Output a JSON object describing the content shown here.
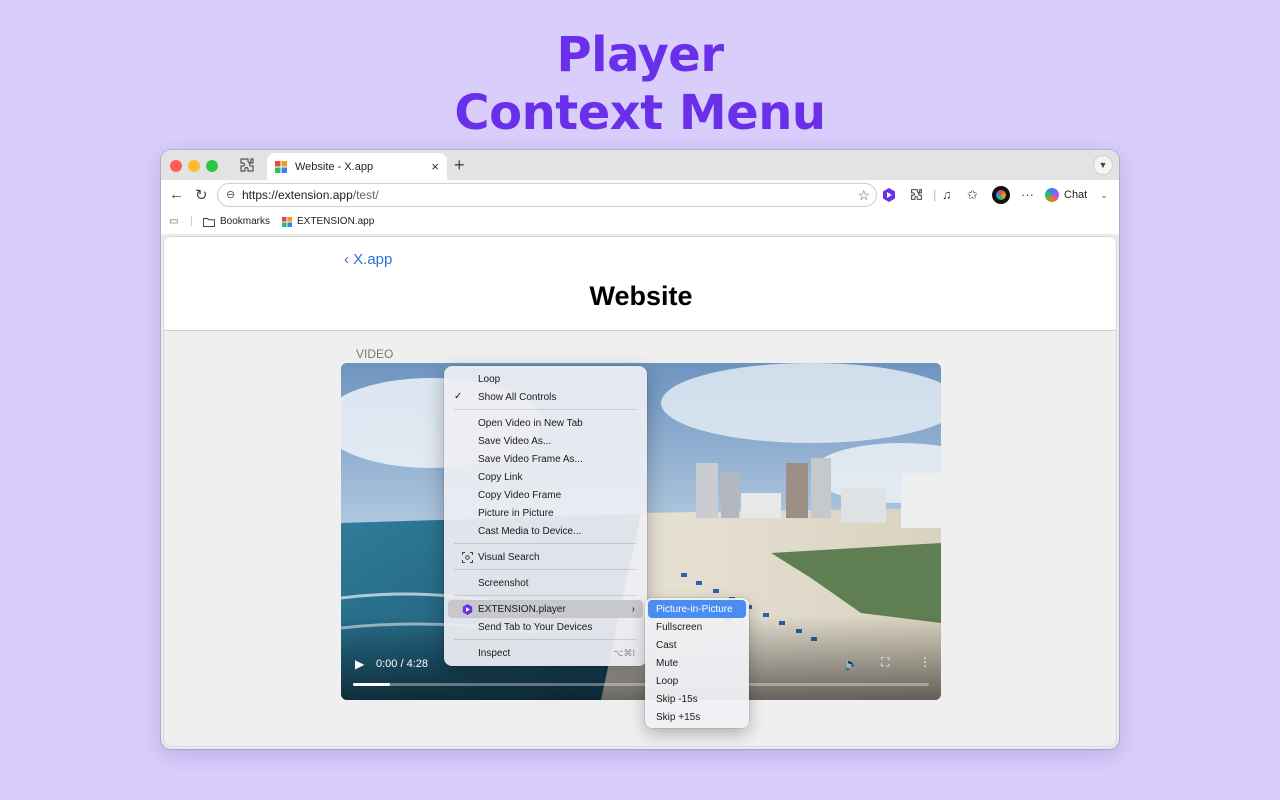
{
  "hero": {
    "line1": "Player",
    "line2": "Context Menu"
  },
  "browser": {
    "tab_title": "Website - X.app",
    "tab_close": "×",
    "new_tab": "+",
    "url_host": "https://extension.app",
    "url_path": "/test/",
    "chat_label": "Chat",
    "bookmarks": [
      {
        "label": "Bookmarks"
      },
      {
        "label": "EXTENSION.app"
      }
    ]
  },
  "page": {
    "back_label": "X.app",
    "title": "Website",
    "section_label": "VIDEO"
  },
  "video": {
    "time": "0:00 / 4:28",
    "progress_fraction": 0.065
  },
  "context_menu": {
    "items": [
      {
        "label": "Loop"
      },
      {
        "label": "Show All Controls",
        "checked": "✓"
      },
      {
        "label": "Open Video in New Tab"
      },
      {
        "label": "Save Video As..."
      },
      {
        "label": "Save Video Frame As..."
      },
      {
        "label": "Copy Link"
      },
      {
        "label": "Copy Video Frame"
      },
      {
        "label": "Picture in Picture"
      },
      {
        "label": "Cast Media to Device..."
      },
      {
        "label": "Visual Search"
      },
      {
        "label": "Screenshot"
      },
      {
        "label": "EXTENSION.player",
        "arrow": "›"
      },
      {
        "label": "Send Tab to Your Devices"
      },
      {
        "label": "Inspect",
        "shortcut": "⌥⌘I"
      }
    ]
  },
  "submenu": {
    "items": [
      {
        "label": "Picture-in-Picture"
      },
      {
        "label": "Fullscreen"
      },
      {
        "label": "Cast"
      },
      {
        "label": "Mute"
      },
      {
        "label": "Loop"
      },
      {
        "label": "Skip -15s"
      },
      {
        "label": "Skip +15s"
      }
    ]
  },
  "colors": {
    "background": "#d8cdfb",
    "hero_text": "#6a2fe8",
    "link": "#2f6fd6",
    "submenu_highlight": "#4a8cf0"
  }
}
